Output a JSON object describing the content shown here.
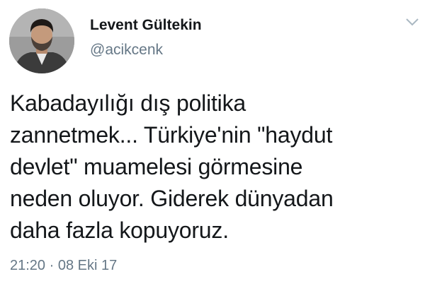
{
  "tweet": {
    "author": {
      "display_name": "Levent Gültekin",
      "handle": "@acikcenk",
      "avatar_icon": "profile-photo-man"
    },
    "text": "Kabadayılığı dış politika\nzannetmek...  Türkiye'nin \"haydut\ndevlet\" muamelesi görmesine\nneden oluyor. Giderek dünyadan\ndaha fazla kopuyoruz.",
    "timestamp": "21:20 · 08 Eki 17",
    "menu_icon": "chevron-down-icon"
  },
  "colors": {
    "text": "#14171a",
    "secondary": "#657786",
    "background": "#ffffff"
  }
}
